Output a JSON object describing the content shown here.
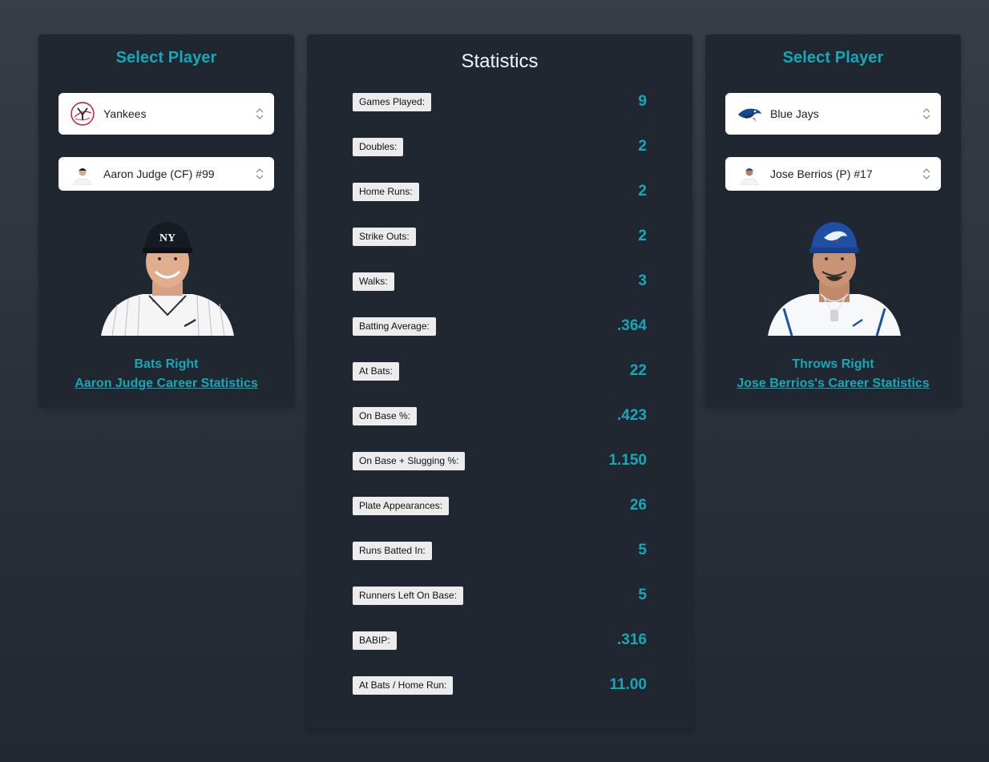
{
  "left": {
    "title": "Select Player",
    "team": {
      "name": "Yankees",
      "logo": "yankees-logo"
    },
    "player": {
      "label": "Aaron Judge (CF) #99",
      "thumb": "player-thumbnail"
    },
    "hand": "Bats Right",
    "career_link": "Aaron Judge Career Statistics"
  },
  "right": {
    "title": "Select Player",
    "team": {
      "name": "Blue Jays",
      "logo": "blue-jays-logo"
    },
    "player": {
      "label": "Jose Berrios (P) #17",
      "thumb": "player-thumbnail"
    },
    "hand": "Throws Right",
    "career_link": "Jose Berrios's Career Statistics"
  },
  "stats": {
    "title": "Statistics",
    "rows": [
      {
        "label": "Games Played:",
        "value": "9"
      },
      {
        "label": "Doubles:",
        "value": "2"
      },
      {
        "label": "Home Runs:",
        "value": "2"
      },
      {
        "label": "Strike Outs:",
        "value": "2"
      },
      {
        "label": "Walks:",
        "value": "3"
      },
      {
        "label": "Batting Average:",
        "value": ".364"
      },
      {
        "label": "At Bats:",
        "value": "22"
      },
      {
        "label": "On Base %:",
        "value": ".423"
      },
      {
        "label": "On Base + Slugging %:",
        "value": "1.150"
      },
      {
        "label": "Plate Appearances:",
        "value": "26"
      },
      {
        "label": "Runs Batted In:",
        "value": "5"
      },
      {
        "label": "Runners Left On Base:",
        "value": "5"
      },
      {
        "label": "BABIP:",
        "value": ".316"
      },
      {
        "label": "At Bats / Home Run:",
        "value": "11.00"
      }
    ]
  },
  "colors": {
    "accent": "#14a9b8",
    "panel": "#212731",
    "background": "#2f343e"
  }
}
